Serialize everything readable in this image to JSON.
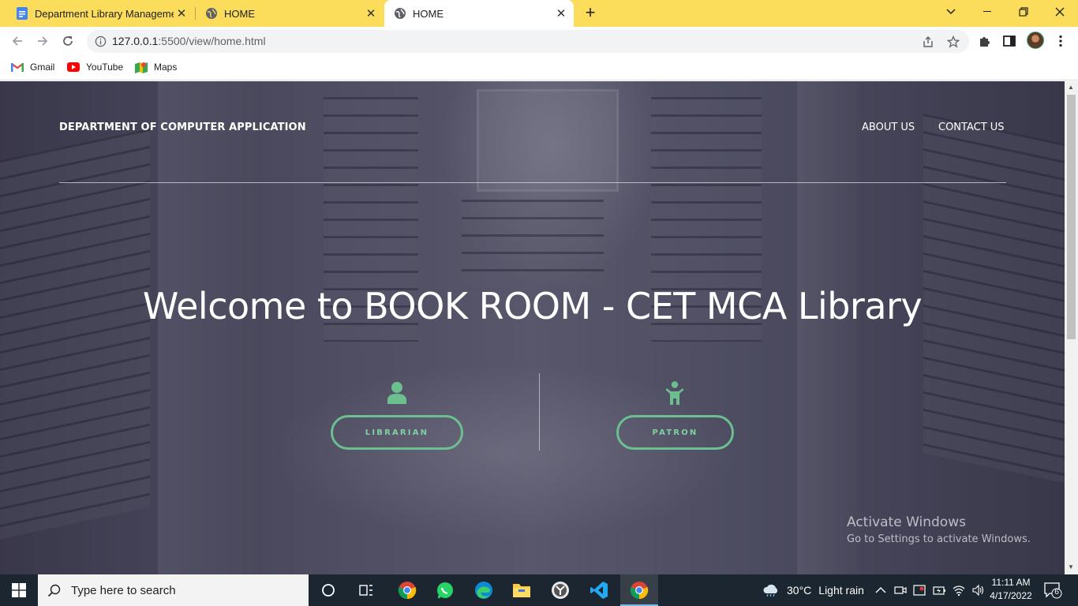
{
  "browser": {
    "tabs": [
      {
        "title": "Department Library Management",
        "favicon": "google-docs-icon",
        "active": false
      },
      {
        "title": "HOME",
        "favicon": "globe-icon",
        "active": false
      },
      {
        "title": "HOME",
        "favicon": "globe-icon",
        "active": true
      }
    ],
    "url_host": "127.0.0.1",
    "url_rest": ":5500/view/home.html",
    "bookmarks": [
      {
        "label": "Gmail",
        "icon": "gmail-icon"
      },
      {
        "label": "YouTube",
        "icon": "youtube-icon"
      },
      {
        "label": "Maps",
        "icon": "maps-icon"
      }
    ]
  },
  "page": {
    "brand": "DEPARTMENT OF COMPUTER APPLICATION",
    "nav": [
      "ABOUT US",
      "CONTACT US"
    ],
    "hero_title": "Welcome to BOOK ROOM - CET MCA Library",
    "roles": [
      {
        "label": "LIBRARIAN",
        "icon": "user-icon"
      },
      {
        "label": "PATRON",
        "icon": "child-icon"
      }
    ],
    "accent_color": "#6cc08f"
  },
  "watermark": {
    "line1": "Activate Windows",
    "line2": "Go to Settings to activate Windows."
  },
  "taskbar": {
    "search_placeholder": "Type here to search",
    "weather_temp": "30°C",
    "weather_desc": "Light rain",
    "time": "11:11 AM",
    "date": "4/17/2022",
    "notification_count": "6"
  }
}
